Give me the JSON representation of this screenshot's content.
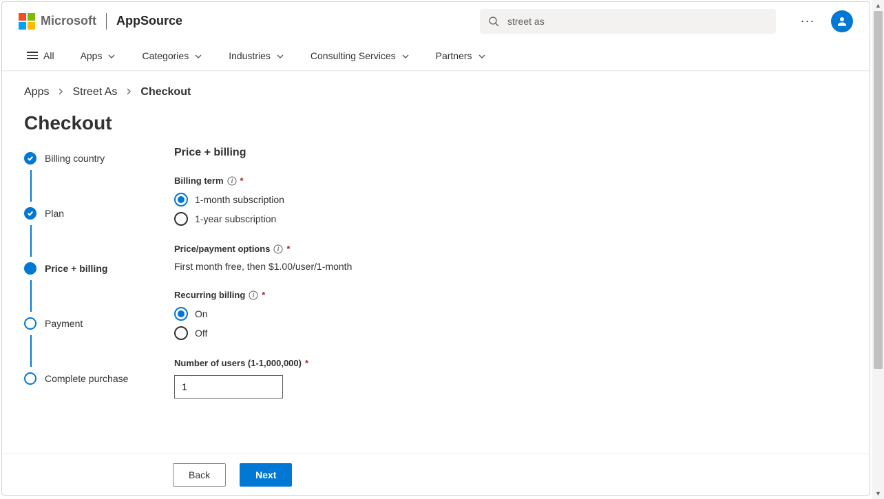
{
  "header": {
    "ms_word": "Microsoft",
    "brand": "AppSource",
    "search_value": "street as",
    "more_label": "···"
  },
  "nav": {
    "all": "All",
    "items": [
      "Apps",
      "Categories",
      "Industries",
      "Consulting Services",
      "Partners"
    ]
  },
  "breadcrumb": {
    "a": "Apps",
    "b": "Street As",
    "c": "Checkout"
  },
  "page_title": "Checkout",
  "steps": {
    "s0": "Billing country",
    "s1": "Plan",
    "s2": "Price + billing",
    "s3": "Payment",
    "s4": "Complete purchase"
  },
  "form": {
    "section": "Price + billing",
    "billing_term_label": "Billing term",
    "term_opt1": "1-month subscription",
    "term_opt2": "1-year subscription",
    "price_options_label": "Price/payment options",
    "price_options_text": "First month free, then $1.00/user/1-month",
    "recurring_label": "Recurring billing",
    "recurring_on": "On",
    "recurring_off": "Off",
    "users_label": "Number of users (1-1,000,000)",
    "users_value": "1"
  },
  "footer": {
    "back": "Back",
    "next": "Next"
  },
  "required_mark": "*"
}
